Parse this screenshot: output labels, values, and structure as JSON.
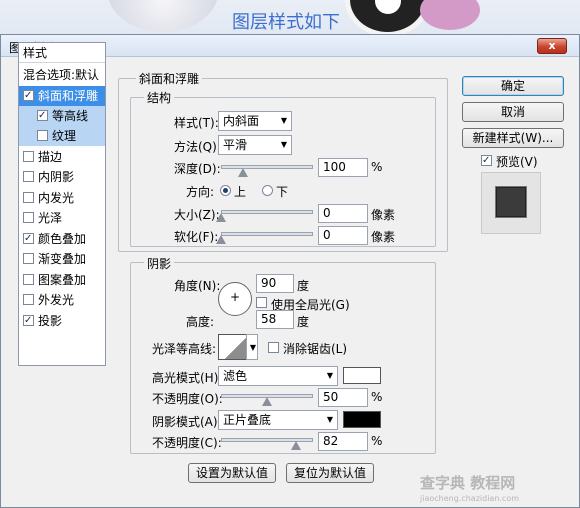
{
  "background": {
    "top_caption": "图层样式如下"
  },
  "dialog": {
    "title": "图层样式",
    "close_glyph": "x"
  },
  "style_list": {
    "header": "样式",
    "blend_options": "混合选项:默认",
    "items": [
      {
        "label": "斜面和浮雕",
        "checked": true
      },
      {
        "label": "等高线",
        "checked": true
      },
      {
        "label": "纹理",
        "checked": false
      },
      {
        "label": "描边",
        "checked": false
      },
      {
        "label": "内阴影",
        "checked": false
      },
      {
        "label": "内发光",
        "checked": false
      },
      {
        "label": "光泽",
        "checked": false
      },
      {
        "label": "颜色叠加",
        "checked": true
      },
      {
        "label": "渐变叠加",
        "checked": false
      },
      {
        "label": "图案叠加",
        "checked": false
      },
      {
        "label": "外发光",
        "checked": false
      },
      {
        "label": "投影",
        "checked": true
      }
    ]
  },
  "bevel": {
    "group_label": "斜面和浮雕",
    "structure_label": "结构",
    "style_label": "样式(T):",
    "style_value": "内斜面",
    "technique_label": "方法(Q):",
    "technique_value": "平滑",
    "depth_label": "深度(D):",
    "depth_value": "100",
    "depth_unit": "%",
    "direction_label": "方向:",
    "direction_up": "上",
    "direction_down": "下",
    "size_label": "大小(Z):",
    "size_value": "0",
    "size_unit": "像素",
    "soften_label": "软化(F):",
    "soften_value": "0",
    "soften_unit": "像素"
  },
  "shading": {
    "group_label": "阴影",
    "angle_label": "角度(N):",
    "angle_value": "90",
    "angle_unit": "度",
    "global_light_label": "使用全局光(G)",
    "altitude_label": "高度:",
    "altitude_value": "58",
    "altitude_unit": "度",
    "gloss_label": "光泽等高线:",
    "antialias_label": "消除锯齿(L)",
    "highlight_mode_label": "高光模式(H):",
    "highlight_mode_value": "滤色",
    "highlight_color": "#ffffff",
    "highlight_opacity_label": "不透明度(O):",
    "highlight_opacity_value": "50",
    "highlight_opacity_unit": "%",
    "shadow_mode_label": "阴影模式(A):",
    "shadow_mode_value": "正片叠底",
    "shadow_color": "#000000",
    "shadow_opacity_label": "不透明度(C):",
    "shadow_opacity_value": "82",
    "shadow_opacity_unit": "%"
  },
  "footer": {
    "make_default": "设置为默认值",
    "reset_default": "复位为默认值"
  },
  "right_panel": {
    "ok": "确定",
    "cancel": "取消",
    "new_style": "新建样式(W)...",
    "preview_label": "预览(V)"
  },
  "watermark": {
    "text": "查字典 教程网",
    "url": "jiaocheng.chazidian.com"
  }
}
